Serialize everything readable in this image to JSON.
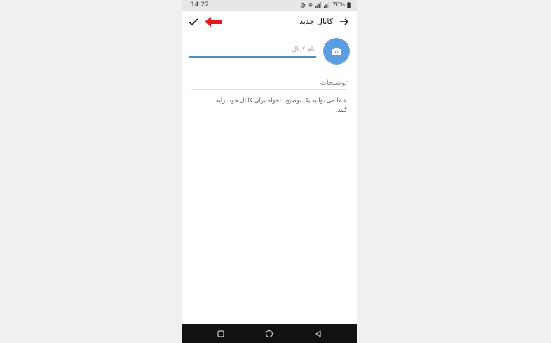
{
  "status_bar": {
    "time": "14:22",
    "battery": "76%"
  },
  "app_bar": {
    "title": "کانال جدید",
    "back_icon": "arrow-right-icon",
    "confirm_icon": "check-icon"
  },
  "annotation": {
    "color": "#e21b1b"
  },
  "form": {
    "name_placeholder": "نام کانال",
    "name_value": "",
    "description_placeholder": "توضیحات",
    "description_value": "",
    "helper_text": "شما می توانید یک توضیح دلخواه برای کانال خود ارایه کنید."
  },
  "colors": {
    "accent": "#4a90c8",
    "avatar": "#5b9ee2"
  }
}
